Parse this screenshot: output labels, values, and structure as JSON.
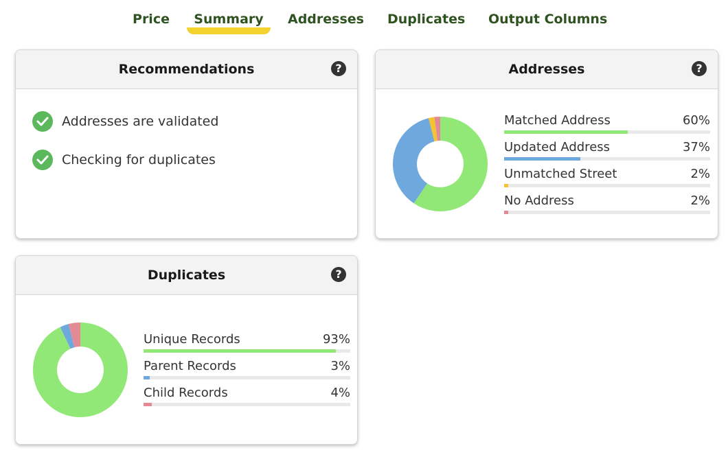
{
  "tabs": [
    {
      "label": "Price",
      "active": false
    },
    {
      "label": "Summary",
      "active": true
    },
    {
      "label": "Addresses",
      "active": false
    },
    {
      "label": "Duplicates",
      "active": false
    },
    {
      "label": "Output Columns",
      "active": false
    }
  ],
  "recommendations": {
    "title": "Recommendations",
    "help_icon": "question-circle-icon",
    "items": [
      {
        "text": "Addresses are validated",
        "icon": "check-circle-icon"
      },
      {
        "text": "Checking for duplicates",
        "icon": "check-circle-icon"
      }
    ]
  },
  "addresses": {
    "title": "Addresses",
    "help_icon": "question-circle-icon",
    "chart_data": {
      "type": "pie",
      "categories": [
        "Matched Address",
        "Updated Address",
        "Unmatched Street",
        "No Address"
      ],
      "values": [
        60,
        37,
        2,
        2
      ],
      "value_labels": [
        "60%",
        "37%",
        "2%",
        "2%"
      ],
      "colors": [
        "#92e877",
        "#6fa8dc",
        "#f4c430",
        "#e48a96"
      ]
    }
  },
  "duplicates": {
    "title": "Duplicates",
    "help_icon": "question-circle-icon",
    "chart_data": {
      "type": "pie",
      "categories": [
        "Unique Records",
        "Parent Records",
        "Child Records"
      ],
      "values": [
        93,
        3,
        4
      ],
      "value_labels": [
        "93%",
        "3%",
        "4%"
      ],
      "colors": [
        "#92e877",
        "#6fa8dc",
        "#e48a96"
      ]
    }
  }
}
